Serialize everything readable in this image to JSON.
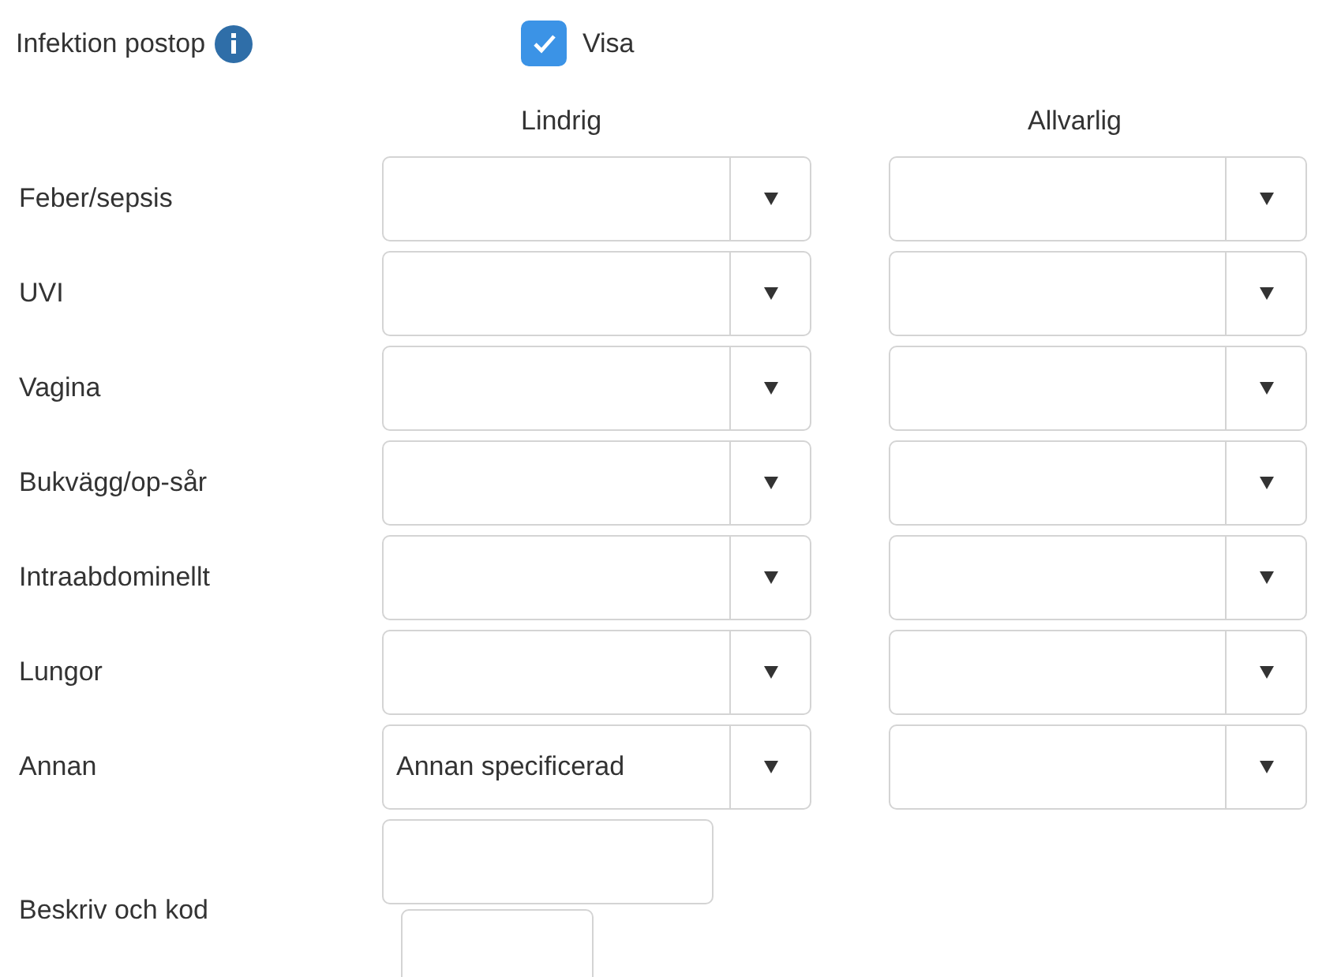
{
  "section": {
    "title": "Infektion postop",
    "show_checkbox": {
      "label": "Visa",
      "checked": true
    }
  },
  "columns": [
    "Lindrig",
    "Allvarlig"
  ],
  "rows": [
    {
      "label": "Feber/sepsis",
      "cells": [
        {
          "kind": "dropdown"
        },
        {
          "kind": "dropdown"
        }
      ]
    },
    {
      "label": "UVI",
      "cells": [
        {
          "kind": "dropdown"
        },
        {
          "kind": "dropdown"
        }
      ]
    },
    {
      "label": "Vagina",
      "cells": [
        {
          "kind": "dropdown"
        },
        {
          "kind": "dropdown"
        }
      ]
    },
    {
      "label": "Bukvägg/op-sår",
      "cells": [
        {
          "kind": "dropdown"
        },
        {
          "kind": "dropdown"
        }
      ]
    },
    {
      "label": "Intraabdominellt",
      "cells": [
        {
          "kind": "dropdown"
        },
        {
          "kind": "dropdown"
        }
      ]
    },
    {
      "label": "Lungor",
      "cells": [
        {
          "kind": "dropdown"
        },
        {
          "kind": "dropdown"
        }
      ]
    },
    {
      "label": "Annan",
      "cells": [
        {
          "kind": "dropdown",
          "value": "Annan specificerad"
        },
        {
          "kind": "dropdown"
        }
      ]
    }
  ],
  "describe": {
    "label": "Beskriv och kod"
  }
}
